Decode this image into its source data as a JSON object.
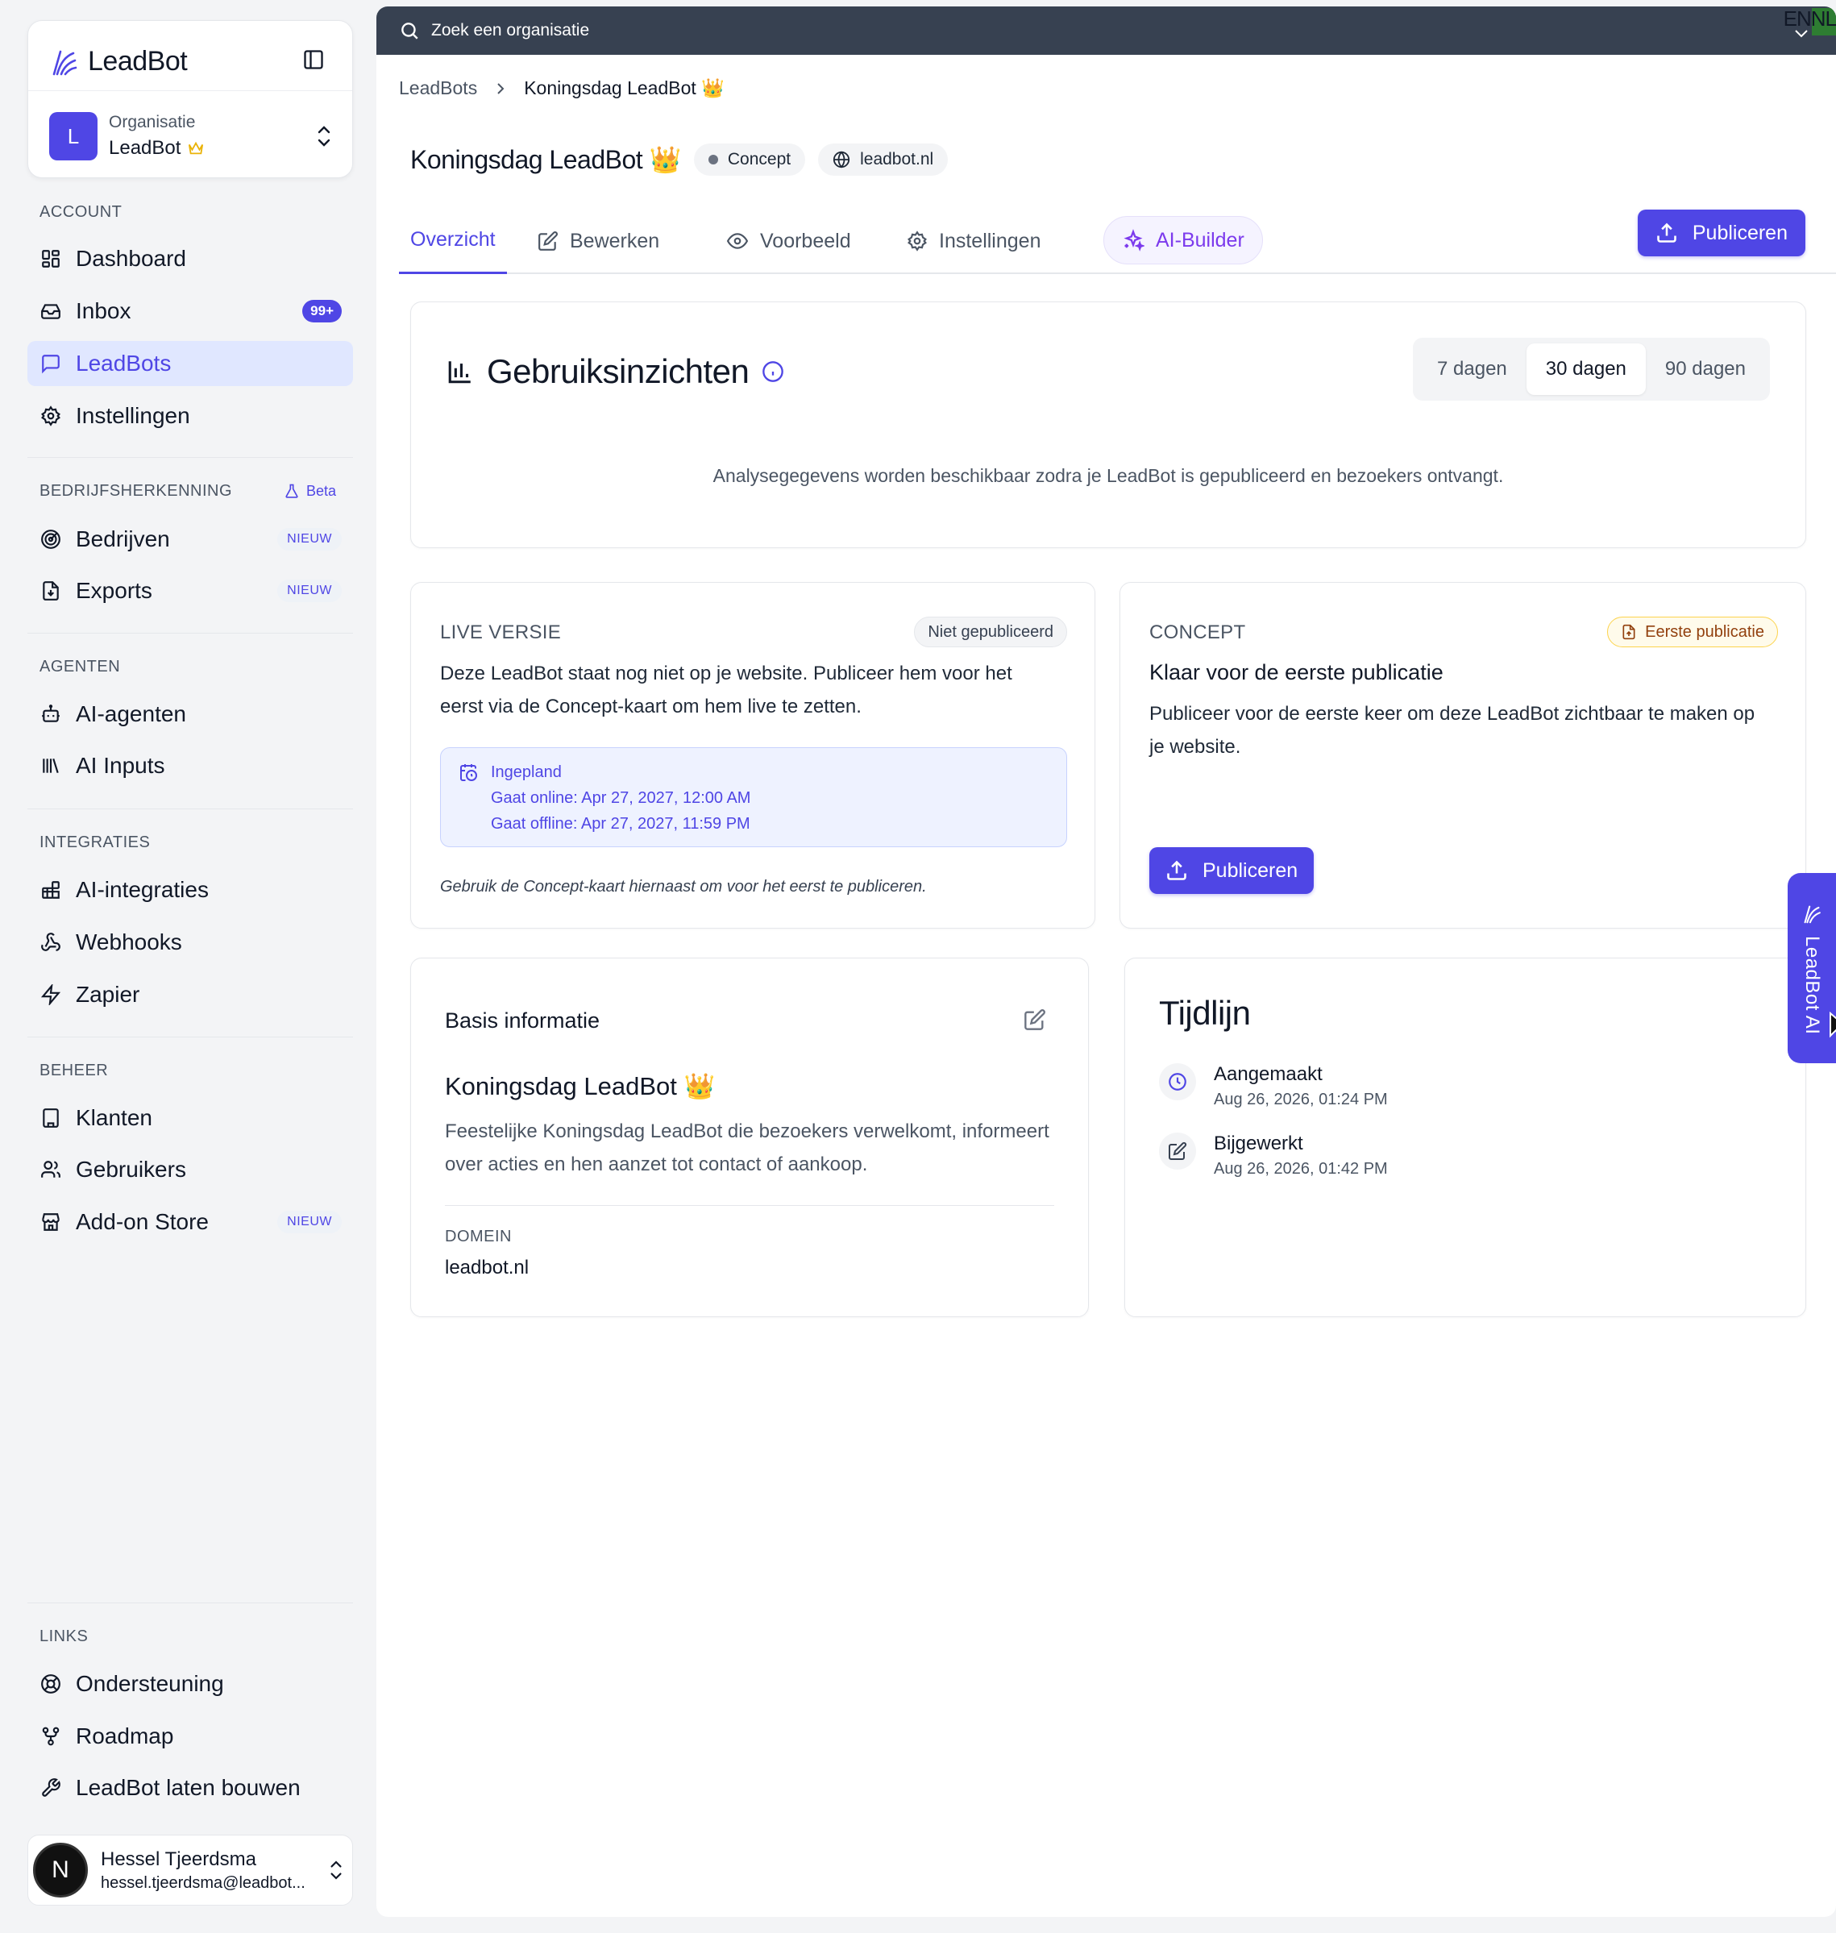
{
  "sidebar": {
    "brand": "LeadBot",
    "org_label": "Organisatie",
    "org_name": "LeadBot",
    "org_initial": "L",
    "sections": {
      "account": "ACCOUNT",
      "bedrijfsherkenning": "BEDRIJFSHERKENNING",
      "beta": "Beta",
      "agenten": "AGENTEN",
      "integraties": "INTEGRATIES",
      "beheer": "BEHEER",
      "links": "LINKS"
    },
    "items": {
      "dashboard": "Dashboard",
      "inbox": "Inbox",
      "inbox_badge": "99+",
      "leadbots": "LeadBots",
      "instellingen": "Instellingen",
      "bedrijven": "Bedrijven",
      "exports": "Exports",
      "ai_agenten": "AI-agenten",
      "ai_inputs": "AI Inputs",
      "ai_integraties": "AI-integraties",
      "webhooks": "Webhooks",
      "zapier": "Zapier",
      "klanten": "Klanten",
      "gebruikers": "Gebruikers",
      "addon_store": "Add-on Store",
      "ondersteuning": "Ondersteuning",
      "roadmap": "Roadmap",
      "laten_bouwen": "LeadBot laten bouwen",
      "new_badge": "NIEUW"
    },
    "user": {
      "initial": "N",
      "name": "Hessel Tjeerdsma",
      "email": "hessel.tjeerdsma@leadbot..."
    }
  },
  "topbar": {
    "search_placeholder": "Zoek een organisatie",
    "language": "ENNL"
  },
  "breadcrumb": {
    "parent": "LeadBots",
    "current": "Koningsdag LeadBot 👑"
  },
  "header": {
    "title": "Koningsdag LeadBot 👑",
    "status": "Concept",
    "domain": "leadbot.nl"
  },
  "tabs": {
    "overzicht": "Overzicht",
    "bewerken": "Bewerken",
    "voorbeeld": "Voorbeeld",
    "instellingen": "Instellingen",
    "ai_builder": "AI-Builder",
    "publish": "Publiceren"
  },
  "insights": {
    "title": "Gebruiksinzichten",
    "periods": [
      "7 dagen",
      "30 dagen",
      "90 dagen"
    ],
    "selected_period": "30 dagen",
    "message": "Analysegegevens worden beschikbaar zodra je LeadBot is gepubliceerd en bezoekers ontvangt."
  },
  "live": {
    "label": "LIVE VERSIE",
    "status": "Niet gepubliceerd",
    "text": "Deze LeadBot staat nog niet op je website. Publiceer hem voor het eerst via de Concept-kaart om hem live te zetten.",
    "schedule_title": "Ingepland",
    "schedule_online": "Gaat online: Apr 27, 2027, 12:00 AM",
    "schedule_offline": "Gaat offline: Apr 27, 2027, 11:59 PM",
    "note": "Gebruik de Concept-kaart hiernaast om voor het eerst te publiceren."
  },
  "concept": {
    "label": "CONCEPT",
    "badge": "Eerste publicatie",
    "heading": "Klaar voor de eerste publicatie",
    "text": "Publiceer voor de eerste keer om deze LeadBot zichtbaar te maken op je website.",
    "button": "Publiceren"
  },
  "basis": {
    "title": "Basis informatie",
    "name": "Koningsdag LeadBot 👑",
    "description": "Feestelijke Koningsdag LeadBot die bezoekers verwelkomt, informeert over acties en hen aanzet tot contact of aankoop.",
    "domain_label": "DOMEIN",
    "domain": "leadbot.nl"
  },
  "timeline": {
    "title": "Tijdlijn",
    "items": [
      {
        "label": "Aangemaakt",
        "date": "Aug 26, 2026, 01:24 PM",
        "icon": "clock-icon"
      },
      {
        "label": "Bijgewerkt",
        "date": "Aug 26, 2026, 01:42 PM",
        "icon": "edit-icon"
      }
    ]
  },
  "ai_tab": {
    "label": "LeadBot AI"
  },
  "colors": {
    "accent": "#4f46e5",
    "sidebar_active_bg": "#e0e7ff",
    "topbar": "#374151"
  }
}
